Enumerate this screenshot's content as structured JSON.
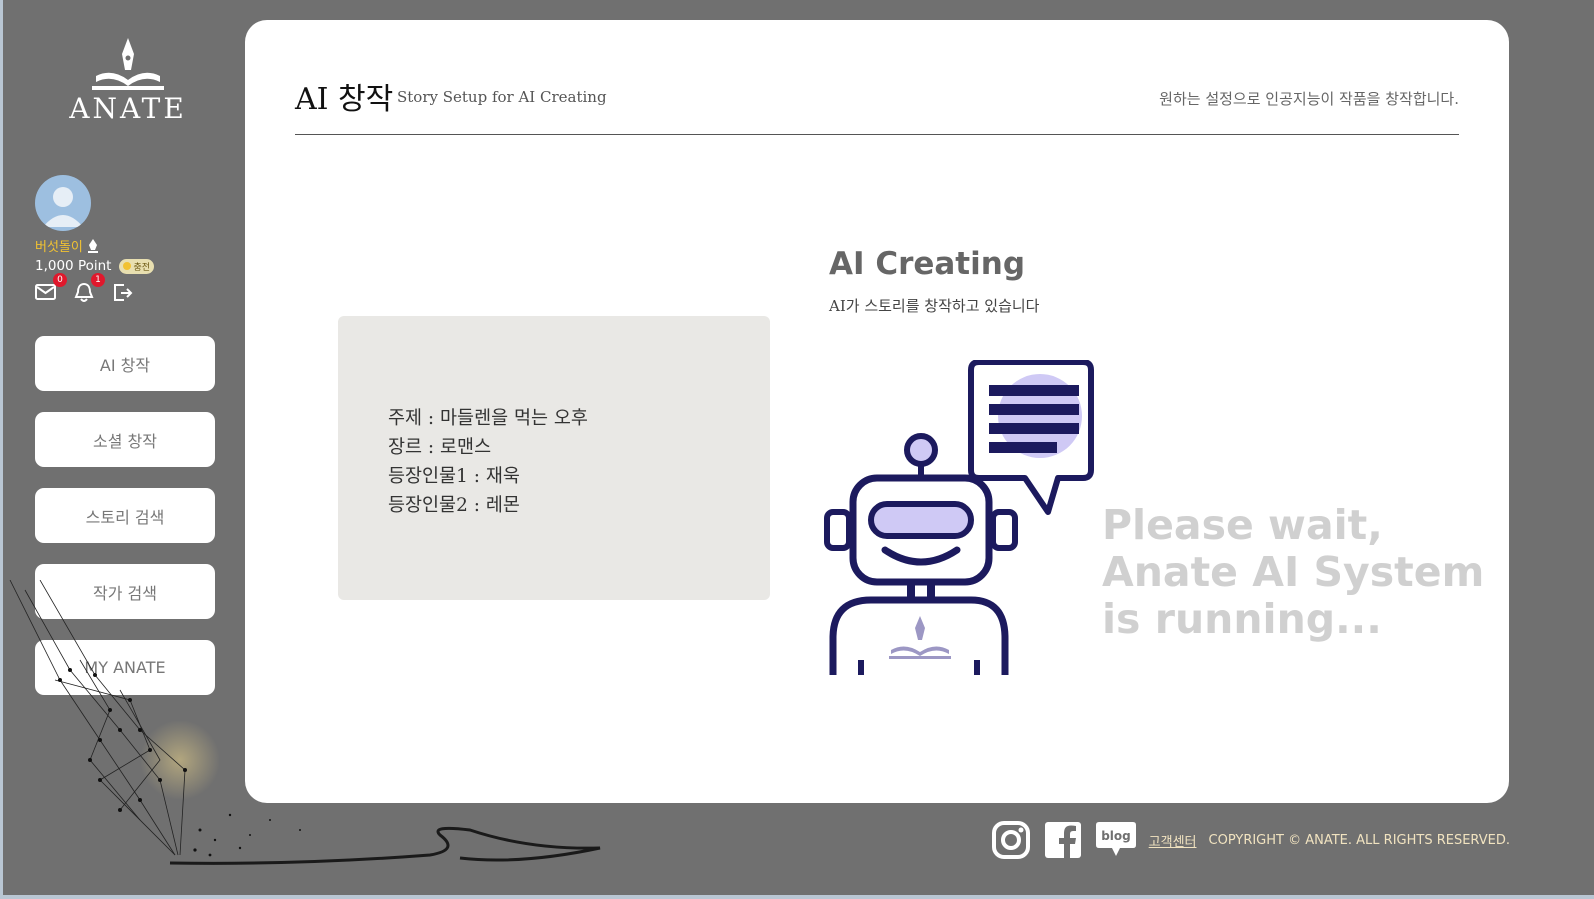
{
  "brand": {
    "logo_text": "ANATE"
  },
  "user": {
    "name": "버섯돌이",
    "points": "1,000 Point",
    "charge_label": "충전",
    "mail_count": "0",
    "notification_count": "1"
  },
  "menu": {
    "items": [
      {
        "label": "AI 창작"
      },
      {
        "label": "소셜 창작"
      },
      {
        "label": "스토리 검색"
      },
      {
        "label": "작가 검색"
      },
      {
        "label": "MY ANATE"
      }
    ]
  },
  "header": {
    "title": "AI 창작",
    "subtitle": "Story Setup for AI Creating",
    "description": "원하는 설정으로 인공지능이 작품을 창작합니다."
  },
  "setup": {
    "lines": [
      "주제 : 마들렌을 먹는 오후",
      "장르 : 로맨스",
      "등장인물1 : 재욱",
      "등장인물2 : 레몬"
    ]
  },
  "status": {
    "title": "AI Creating",
    "subtitle": "AI가 스토리를 창작하고 있습니다",
    "wait_lines": [
      "Please wait,",
      "Anate AI System",
      "is running..."
    ]
  },
  "footer": {
    "social_icons": [
      "instagram-icon",
      "facebook-icon",
      "blog-icon"
    ],
    "blog_label": "blog",
    "support_link": "고객센터",
    "copyright": "COPYRIGHT © ANATE. ALL RIGHTS RESERVED."
  },
  "colors": {
    "background": "#707070",
    "card": "#ffffff",
    "robot_navy": "#1c1a5e",
    "robot_lavender": "#cfc9f5",
    "username_gold": "#f1c232"
  }
}
